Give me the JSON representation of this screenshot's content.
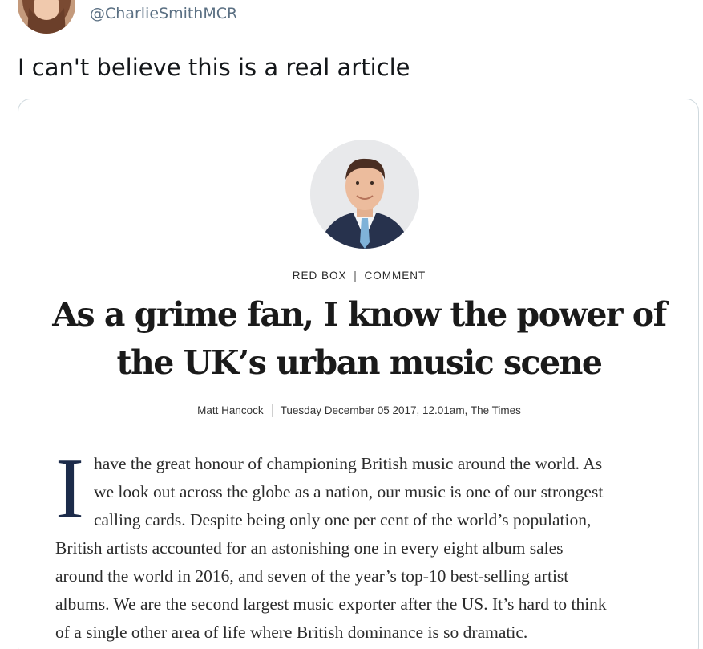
{
  "tweet": {
    "handle": "@CharlieSmithMCR",
    "text": "I can't believe this is a real article"
  },
  "article": {
    "kicker_section": "RED BOX",
    "kicker_type": "COMMENT",
    "kicker_separator": "|",
    "headline_line1": "As a grime fan, I know the power of",
    "headline_line2": "the UK’s urban music scene",
    "author": "Matt Hancock",
    "dateline": "Tuesday December 05 2017, 12.01am, The Times",
    "dropcap": "I",
    "body_lines": [
      "have the great honour of championing British music around the world. As",
      "we look out across the globe as a nation, our music is one of our strongest",
      "calling cards. Despite being only one per cent of the world’s population,",
      "British artists accounted for an astonishing one in every eight album sales",
      "around the world in 2016, and seven of the year’s top-10 best-selling artist",
      "albums. We are the second largest music exporter after the US. It’s hard to think",
      "of a single other area of life where British dominance is so dramatic."
    ]
  },
  "colors": {
    "handle": "#5b7083",
    "tweet_text": "#14171a",
    "dropcap": "#1c2b4a",
    "card_border": "#cfd9de"
  }
}
